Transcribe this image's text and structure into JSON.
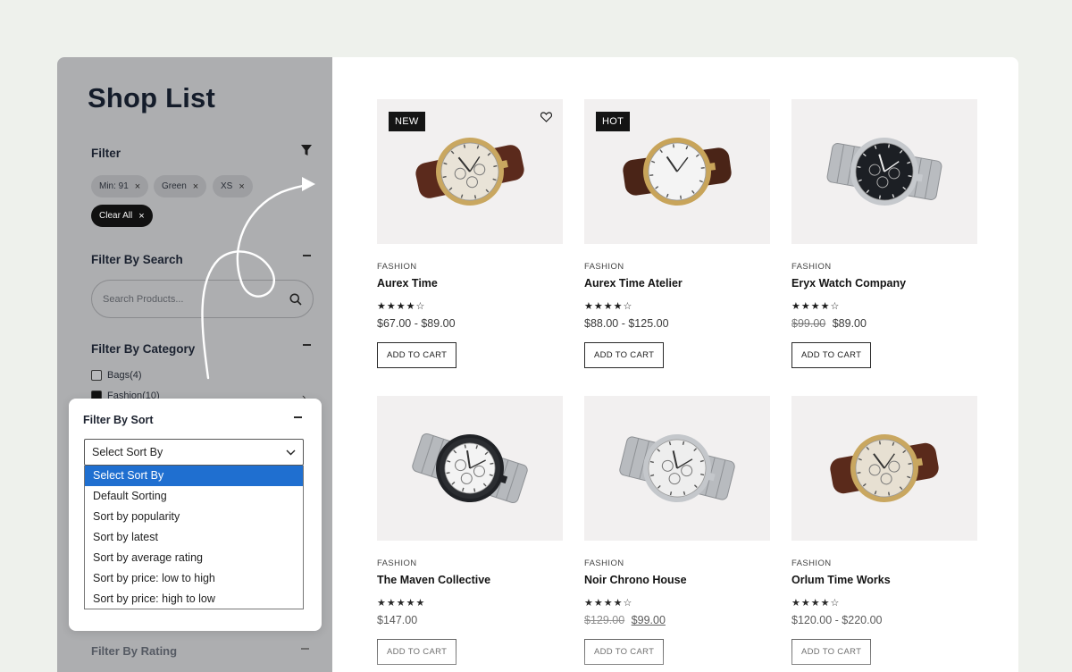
{
  "page": {
    "title": "Shop List"
  },
  "filter": {
    "heading": "Filter",
    "chips": [
      "Min: 91",
      "Green",
      "XS"
    ],
    "clear_label": "Clear All",
    "remove_glyph": "×"
  },
  "search": {
    "heading": "Filter By Search",
    "placeholder": "Search Products..."
  },
  "category": {
    "heading": "Filter By Category",
    "items": [
      {
        "label": "Bags(4)",
        "checked": false
      },
      {
        "label": "Fashion(10)",
        "checked": true
      }
    ]
  },
  "sort": {
    "heading": "Filter By Sort",
    "selected": "Select Sort By",
    "options": [
      "Select Sort By",
      "Default Sorting",
      "Sort by popularity",
      "Sort by latest",
      "Sort by average rating",
      "Sort by price: low to high",
      "Sort by price: high to low"
    ]
  },
  "rating": {
    "heading": "Filter By Rating"
  },
  "products": [
    {
      "badge": "NEW",
      "category": "FASHION",
      "name": "Aurex Time",
      "rating": 4,
      "price": "$67.00 - $89.00",
      "old_price": "",
      "button": "ADD TO CART",
      "strap": "#5b2a1c",
      "dial": "#e9e3d7",
      "case": "#c9a760"
    },
    {
      "badge": "HOT",
      "category": "FASHION",
      "name": "Aurex Time Atelier",
      "rating": 4,
      "price": "$88.00 - $125.00",
      "old_price": "",
      "button": "ADD TO CART",
      "strap": "#4a2417",
      "dial": "#f4f4f4",
      "case": "#c8a45a"
    },
    {
      "badge": "",
      "category": "FASHION",
      "name": "Eryx Watch Company",
      "rating": 4,
      "price": "$89.00",
      "old_price": "$99.00",
      "button": "ADD TO CART",
      "strap": "#b9bcc0",
      "dial": "#1c1f24",
      "case": "#c6c9cd"
    },
    {
      "badge": "",
      "category": "FASHION",
      "name": "The Maven Collective",
      "rating": 5,
      "price": "$147.00",
      "old_price": "",
      "button": "ADD TO CART",
      "strap": "#b6b9bd",
      "dial": "#f3f3f3",
      "case": "#202226"
    },
    {
      "badge": "",
      "category": "FASHION",
      "name": "Noir Chrono House",
      "rating": 4,
      "price": "$99.00",
      "old_price": "$129.00",
      "button": "ADD TO CART",
      "strap": "#b8bbbf",
      "dial": "#eeeeee",
      "case": "#c4c7cb"
    },
    {
      "badge": "",
      "category": "FASHION",
      "name": "Orlum Time Works",
      "rating": 4,
      "price": "$120.00 - $220.00",
      "old_price": "",
      "button": "ADD TO CART",
      "strap": "#5a2a1b",
      "dial": "#e7e0d2",
      "case": "#c9a760"
    }
  ],
  "colors": {
    "sidebar_bg": "#adaeb0",
    "selected_option": "#1f6fd0",
    "page_bg": "#eef1ec"
  }
}
